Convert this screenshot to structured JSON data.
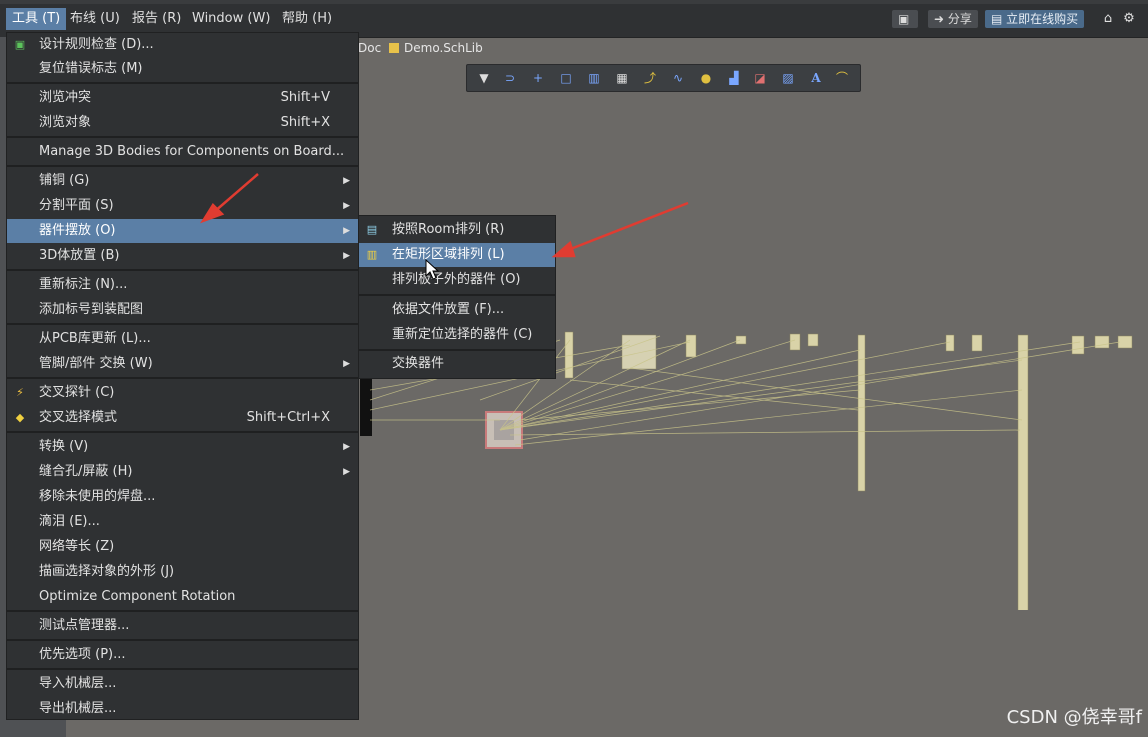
{
  "menubar": {
    "items": [
      {
        "label": "工具 (T)",
        "active": true
      },
      {
        "label": "布线 (U)",
        "active": false
      },
      {
        "label": "报告 (R)",
        "active": false
      },
      {
        "label": "Window (W)",
        "active": false
      },
      {
        "label": "帮助 (H)",
        "active": false
      }
    ],
    "share_label": "分享",
    "buy_label": "立即在线购买"
  },
  "doc_tabs": [
    {
      "label": "Doc"
    },
    {
      "label": "Demo.SchLib"
    }
  ],
  "tools_menu": {
    "items": [
      {
        "label": "设计规则检查 (D)...",
        "shortcut": "",
        "submenu": false,
        "icon": "drc-icon"
      },
      {
        "label": "复位错误标志 (M)",
        "shortcut": "",
        "submenu": false,
        "icon": ""
      },
      {
        "label": "浏览冲突",
        "shortcut": "Shift+V",
        "submenu": false,
        "icon": ""
      },
      {
        "label": "浏览对象",
        "shortcut": "Shift+X",
        "submenu": false,
        "icon": ""
      },
      {
        "label": "Manage 3D Bodies for Components on Board...",
        "shortcut": "",
        "submenu": false,
        "icon": ""
      },
      {
        "label": "铺铜 (G)",
        "shortcut": "",
        "submenu": true,
        "icon": ""
      },
      {
        "label": "分割平面 (S)",
        "shortcut": "",
        "submenu": true,
        "icon": ""
      },
      {
        "label": "器件摆放 (O)",
        "shortcut": "",
        "submenu": true,
        "icon": "",
        "highlighted": true
      },
      {
        "label": "3D体放置 (B)",
        "shortcut": "",
        "submenu": true,
        "icon": ""
      },
      {
        "label": "重新标注 (N)...",
        "shortcut": "",
        "submenu": false,
        "icon": ""
      },
      {
        "label": "添加标号到装配图",
        "shortcut": "",
        "submenu": false,
        "icon": ""
      },
      {
        "label": "从PCB库更新 (L)...",
        "shortcut": "",
        "submenu": false,
        "icon": ""
      },
      {
        "label": "管脚/部件 交换 (W)",
        "shortcut": "",
        "submenu": true,
        "icon": ""
      },
      {
        "label": "交叉探针 (C)",
        "shortcut": "",
        "submenu": false,
        "icon": "cross-probe-icon"
      },
      {
        "label": "交叉选择模式",
        "shortcut": "Shift+Ctrl+X",
        "submenu": false,
        "icon": "cross-select-icon"
      },
      {
        "label": "转换 (V)",
        "shortcut": "",
        "submenu": true,
        "icon": ""
      },
      {
        "label": "缝合孔/屏蔽 (H)",
        "shortcut": "",
        "submenu": true,
        "icon": ""
      },
      {
        "label": "移除未使用的焊盘...",
        "shortcut": "",
        "submenu": false,
        "icon": ""
      },
      {
        "label": "滴泪 (E)...",
        "shortcut": "",
        "submenu": false,
        "icon": ""
      },
      {
        "label": "网络等长 (Z)",
        "shortcut": "",
        "submenu": false,
        "icon": ""
      },
      {
        "label": "描画选择对象的外形 (J)",
        "shortcut": "",
        "submenu": false,
        "icon": ""
      },
      {
        "label": "Optimize Component Rotation",
        "shortcut": "",
        "submenu": false,
        "icon": ""
      },
      {
        "label": "测试点管理器...",
        "shortcut": "",
        "submenu": false,
        "icon": ""
      },
      {
        "label": "优先选项 (P)...",
        "shortcut": "",
        "submenu": false,
        "icon": ""
      },
      {
        "label": "导入机械层...",
        "shortcut": "",
        "submenu": false,
        "icon": ""
      },
      {
        "label": "导出机械层...",
        "shortcut": "",
        "submenu": false,
        "icon": ""
      }
    ]
  },
  "placement_submenu": {
    "items": [
      {
        "label": "按照Room排列 (R)",
        "icon": "room-arrange-icon"
      },
      {
        "label": "在矩形区域排列 (L)",
        "icon": "rect-arrange-icon",
        "highlighted": true
      },
      {
        "label": "排列板子外的器件 (O)",
        "icon": ""
      },
      {
        "label": "依据文件放置 (F)...",
        "icon": ""
      },
      {
        "label": "重新定位选择的器件 (C)",
        "icon": ""
      },
      {
        "label": "交换器件",
        "icon": ""
      }
    ]
  },
  "watermark": "CSDN @侥幸哥f",
  "colors": {
    "menu_bg": "#2f3133",
    "highlight": "#5b7fa6",
    "canvas": "#6b6966",
    "annotation_arrow": "#e03c31"
  }
}
